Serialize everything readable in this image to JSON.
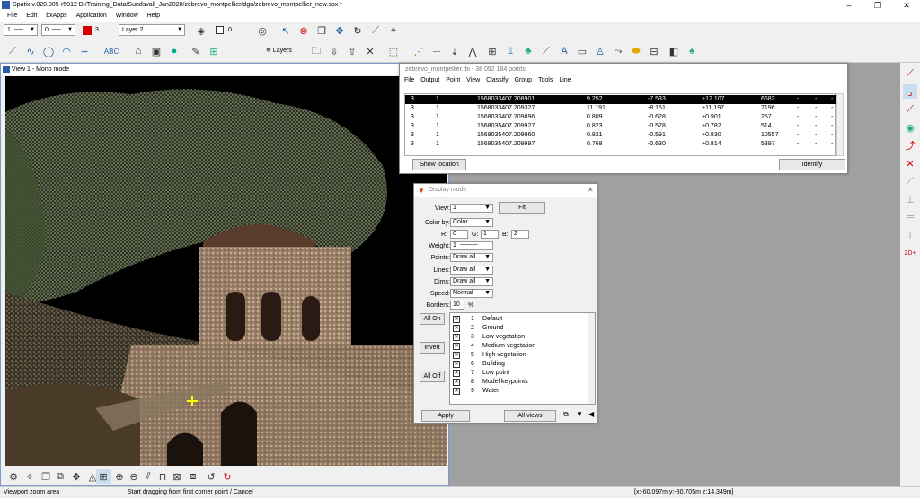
{
  "window": {
    "title": "Spatix v.020.005-r5012  D:/Training_Data/Sundsvall_Jan2020/zebrevo_montpellier/dgn/zebrevo_montpellier_new.spx *",
    "min": "–",
    "max": "❐",
    "close": "✕"
  },
  "menu": [
    "File",
    "Edit",
    "bxApps",
    "Application",
    "Window",
    "Help"
  ],
  "toolbar1": {
    "line_style": "1",
    "line_weight": "0",
    "color_index": "3",
    "layer": "Layer 2",
    "fill_value": "0"
  },
  "toolbar2": {
    "layers_label": "Layers"
  },
  "view": {
    "title": "View 1 - Mono mode"
  },
  "statusbar": {
    "left": "Viewport zoom area",
    "center": "Start dragging from first corner point / Cancel",
    "coords": "[x:-60.097m y:-80.705m z:14.349m]"
  },
  "point_window": {
    "title": "zebrevo_montpellier.fbi - 38 092 184 points",
    "menu": [
      "File",
      "Output",
      "Point",
      "View",
      "Classify",
      "Group",
      "Tools",
      "Line"
    ],
    "rows": [
      [
        "3",
        "1",
        "1568033407.208901",
        "9.252",
        "-7.533",
        "+12.107",
        "6682",
        "-",
        "-",
        "-"
      ],
      [
        "3",
        "1",
        "1568033407.209327",
        "11.191",
        "-8.151",
        "+11.197",
        "7196",
        "-",
        "-",
        "-"
      ],
      [
        "3",
        "1",
        "1568033407.209896",
        "0.809",
        "-0.628",
        "+0.901",
        "257",
        "-",
        "-",
        "-"
      ],
      [
        "3",
        "1",
        "1568035407.209927",
        "0.823",
        "-0.578",
        "+0.782",
        "514",
        "-",
        "-",
        "-"
      ],
      [
        "3",
        "1",
        "1568035407.209960",
        "0.821",
        "-0.591",
        "+0.830",
        "10557",
        "-",
        "-",
        "-"
      ],
      [
        "3",
        "1",
        "1568035407.209997",
        "0.768",
        "-0.630",
        "+0.814",
        "5397",
        "-",
        "-",
        "-"
      ]
    ],
    "show_location": "Show location",
    "identify": "Identify"
  },
  "display_mode": {
    "title": "Display mode",
    "view_label": "View:",
    "view_value": "1",
    "fit": "Fit",
    "color_by_label": "Color by:",
    "color_by_value": "Color",
    "r_label": "R:",
    "r_value": "0",
    "g_label": "G:",
    "g_value": "1",
    "b_label": "B:",
    "b_value": "2",
    "weight_label": "Weight:",
    "weight_value": "1",
    "points_label": "Points:",
    "points_value": "Draw all",
    "lines_label": "Lines:",
    "lines_value": "Draw all",
    "dims_label": "Dims:",
    "dims_value": "Draw all",
    "speed_label": "Speed:",
    "speed_value": "Normal",
    "borders_label": "Borders:",
    "borders_value": "10",
    "borders_unit": "%",
    "all_on": "All On",
    "invert": "Invert",
    "all_off": "All Off",
    "classes": [
      {
        "n": "1",
        "label": "Default"
      },
      {
        "n": "2",
        "label": "Ground"
      },
      {
        "n": "3",
        "label": "Low vegetation"
      },
      {
        "n": "4",
        "label": "Medium vegetation"
      },
      {
        "n": "5",
        "label": "High vegetation"
      },
      {
        "n": "6",
        "label": "Building"
      },
      {
        "n": "7",
        "label": "Low point"
      },
      {
        "n": "8",
        "label": "Model keypoints"
      },
      {
        "n": "9",
        "label": "Water"
      }
    ],
    "apply": "Apply",
    "all_views": "All views"
  },
  "colors": {
    "accent": "#d40000",
    "selection": "#000000",
    "view_border": "#7a9cc8"
  }
}
